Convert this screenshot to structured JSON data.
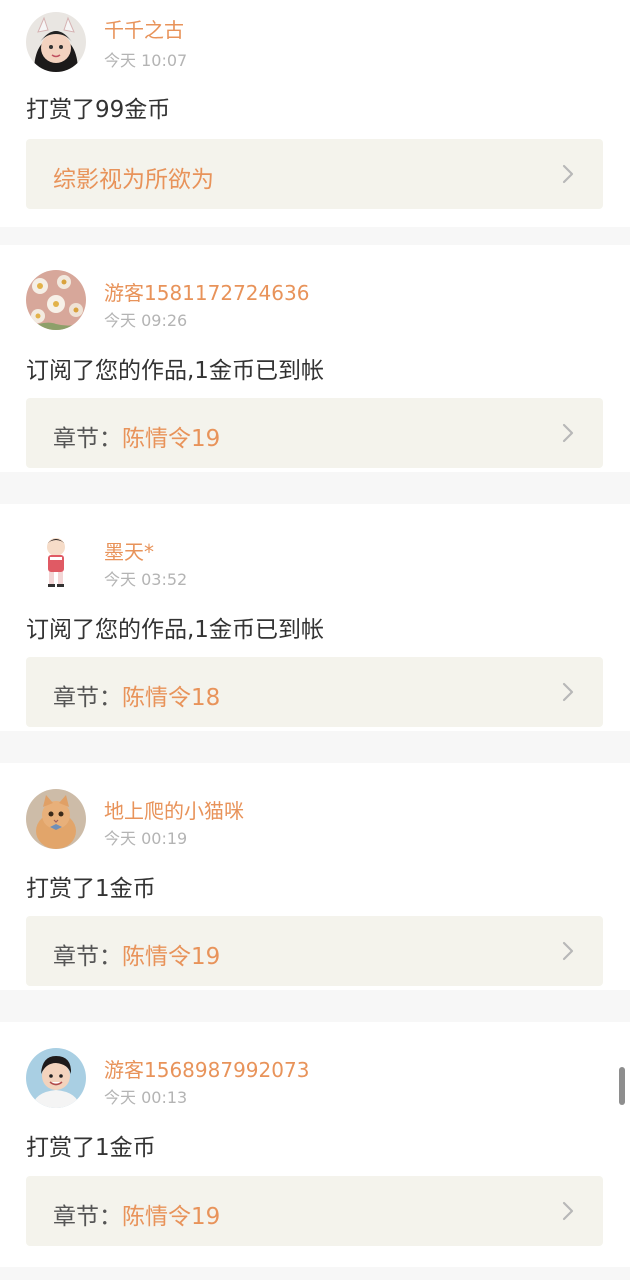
{
  "feed": [
    {
      "username": "千千之古",
      "time": "今天 10:07",
      "message": "打赏了99金币",
      "link_prefix": "",
      "link_title": "综影视为所欲为"
    },
    {
      "username": "游客1581172724636",
      "time": "今天 09:26",
      "message": "订阅了您的作品,1金币已到帐",
      "link_prefix": "章节：",
      "link_title": "陈情令19"
    },
    {
      "username": "墨天*",
      "time": "今天 03:52",
      "message": "订阅了您的作品,1金币已到帐",
      "link_prefix": "章节：",
      "link_title": "陈情令18"
    },
    {
      "username": "地上爬的小猫咪",
      "time": "今天 00:19",
      "message": "打赏了1金币",
      "link_prefix": "章节：",
      "link_title": "陈情令19"
    },
    {
      "username": "游客1568987992073",
      "time": "今天 00:13",
      "message": "打赏了1金币",
      "link_prefix": "章节：",
      "link_title": "陈情令19"
    }
  ],
  "colors": {
    "accent": "#e8935a",
    "link_bg": "#f4f3ec",
    "divider": "#f7f7f7"
  },
  "icons": {
    "chevron": "chevron-right-icon"
  }
}
